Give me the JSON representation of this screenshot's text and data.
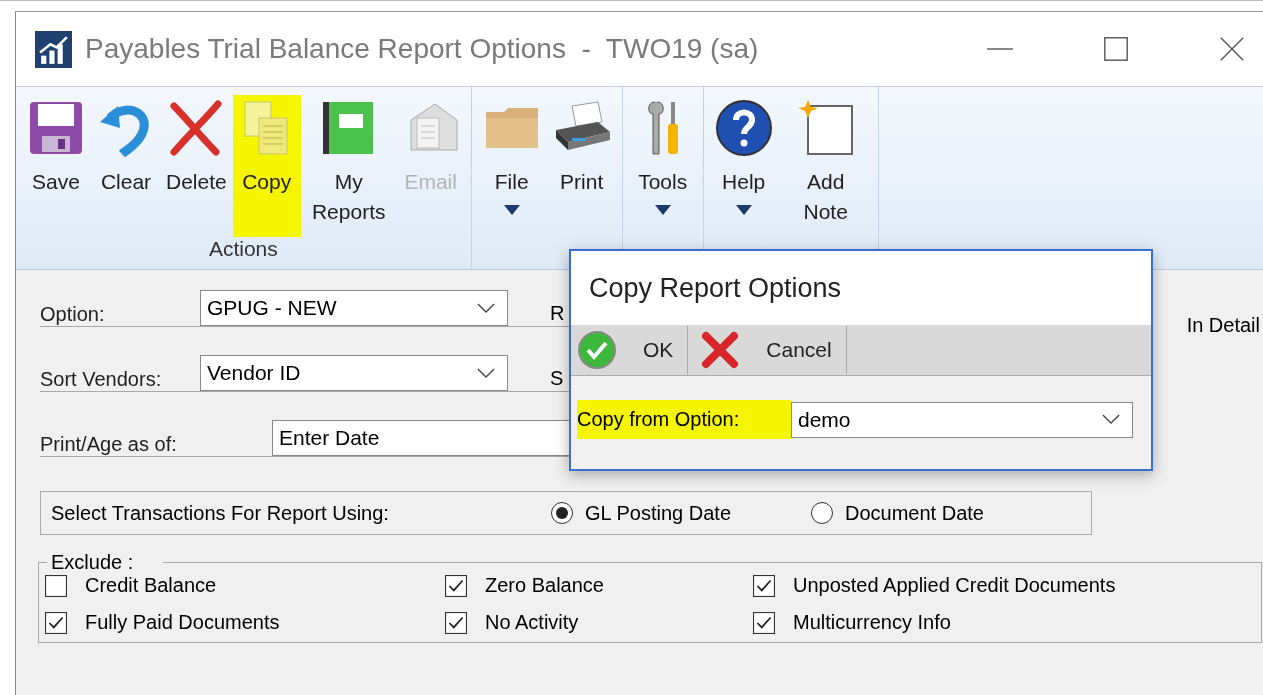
{
  "window": {
    "title": "Payables Trial Balance Report Options  -  TWO19 (sa)"
  },
  "ribbon": {
    "groups": [
      {
        "label": "Actions",
        "buttons": [
          {
            "label": "Save",
            "disabled": false,
            "highlighted": false,
            "dropdown": false
          },
          {
            "label": "Clear",
            "disabled": false,
            "highlighted": false,
            "dropdown": false
          },
          {
            "label": "Delete",
            "disabled": false,
            "highlighted": false,
            "dropdown": false
          },
          {
            "label": "Copy",
            "disabled": false,
            "highlighted": true,
            "dropdown": false
          },
          {
            "label": "My Reports",
            "disabled": false,
            "highlighted": false,
            "dropdown": false
          },
          {
            "label": "Email",
            "disabled": true,
            "highlighted": false,
            "dropdown": false
          }
        ]
      },
      {
        "buttons": [
          {
            "label": "File",
            "disabled": false,
            "highlighted": false,
            "dropdown": true
          },
          {
            "label": "Print",
            "disabled": false,
            "highlighted": false,
            "dropdown": false
          }
        ]
      },
      {
        "buttons": [
          {
            "label": "Tools",
            "disabled": false,
            "highlighted": false,
            "dropdown": true
          }
        ]
      },
      {
        "buttons": [
          {
            "label": "Help",
            "disabled": false,
            "highlighted": false,
            "dropdown": true
          },
          {
            "label": "Add Note",
            "disabled": false,
            "highlighted": false,
            "dropdown": false
          }
        ]
      }
    ]
  },
  "form": {
    "fields": [
      {
        "label": "Option:",
        "value": "GPUG - NEW",
        "kind": "dropdown",
        "side_label": "R"
      },
      {
        "label": "Sort Vendors:",
        "value": "Vendor ID",
        "kind": "dropdown",
        "side_label": "S"
      },
      {
        "label": "Print/Age as of:",
        "value": "Enter Date",
        "kind": "text"
      }
    ],
    "right_label": "In Detail",
    "transactions": {
      "label": "Select Transactions For Report Using:",
      "options": [
        {
          "label": "GL Posting Date",
          "selected": true
        },
        {
          "label": "Document Date",
          "selected": false
        }
      ]
    },
    "exclude": {
      "label": "Exclude :",
      "items": [
        {
          "label": "Credit Balance",
          "checked": false
        },
        {
          "label": "Zero Balance",
          "checked": true
        },
        {
          "label": "Unposted Applied Credit Documents",
          "checked": true
        },
        {
          "label": "Fully Paid Documents",
          "checked": true
        },
        {
          "label": "No Activity",
          "checked": true
        },
        {
          "label": "Multicurrency Info",
          "checked": true
        }
      ]
    }
  },
  "dialog": {
    "title": "Copy Report Options",
    "buttons": [
      {
        "label": "OK"
      },
      {
        "label": "Cancel"
      }
    ],
    "field": {
      "label": "Copy from Option:",
      "value": "demo",
      "highlighted": true
    }
  }
}
